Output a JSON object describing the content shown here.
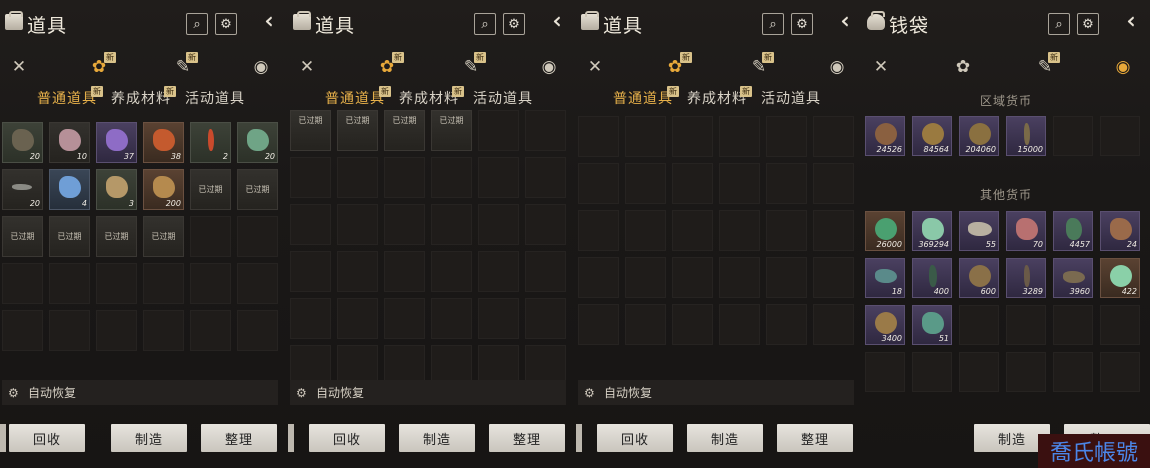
{
  "panels": [
    {
      "title": "道具",
      "subtabs": [
        "普通道具",
        "养成材料",
        "活动道具"
      ],
      "auto_label": "自动恢复",
      "buttons": [
        "回收",
        "制造",
        "整理"
      ],
      "items": [
        {
          "q": "20"
        },
        {
          "q": "10"
        },
        {
          "q": "37"
        },
        {
          "q": "38"
        },
        {
          "q": "2"
        },
        {
          "q": "20"
        },
        {
          "q": "20"
        },
        {
          "q": "4"
        },
        {
          "q": "3"
        },
        {
          "q": "200"
        },
        {
          "e": "已过期"
        },
        {
          "e": "已过期"
        },
        {
          "e": "已过期"
        },
        {
          "e": "已过期"
        },
        {
          "e": "已过期"
        },
        {
          "e": "已过期"
        }
      ]
    },
    {
      "title": "道具",
      "subtabs": [
        "普通道具",
        "养成材料",
        "活动道具"
      ],
      "auto_label": "自动恢复",
      "buttons": [
        "回收",
        "制造",
        "整理"
      ],
      "items": [
        {
          "e": "已过期"
        },
        {
          "e": "已过期"
        },
        {
          "e": "已过期"
        },
        {
          "e": "已过期"
        }
      ]
    },
    {
      "title": "道具",
      "subtabs": [
        "普通道具",
        "养成材料",
        "活动道具"
      ],
      "auto_label": "自动恢复",
      "buttons": [
        "回收",
        "制造",
        "整理"
      ]
    },
    {
      "title": "钱袋",
      "section_regional": "区域货币",
      "section_other": "其他货币",
      "regional": [
        "24526",
        "84564",
        "204060",
        "15000"
      ],
      "other": [
        "26000",
        "369294",
        "55",
        "70",
        "4457",
        "24",
        "18",
        "400",
        "600",
        "3289",
        "3960",
        "422",
        "3400",
        "51"
      ],
      "buttons": [
        "制造",
        "整"
      ]
    }
  ],
  "new_badge": "新",
  "watermark": "喬氏帳號"
}
